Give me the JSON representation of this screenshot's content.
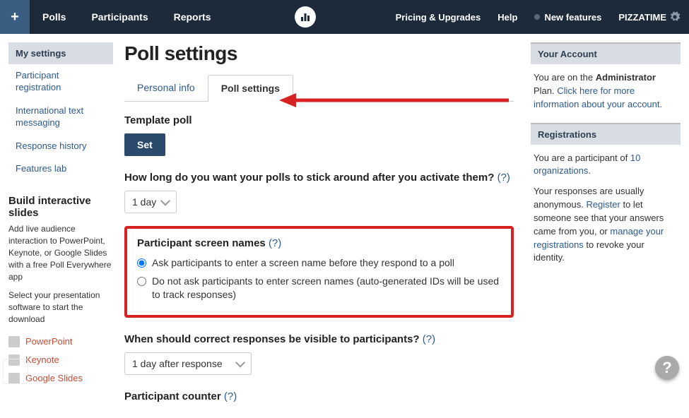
{
  "nav": {
    "plus": "+",
    "items": [
      "Polls",
      "Participants",
      "Reports"
    ],
    "right": [
      "Pricing & Upgrades",
      "Help",
      "New features"
    ],
    "user": "PIZZATIME"
  },
  "sidebar": {
    "tabs": [
      "My settings",
      "Participant registration",
      "International text messaging",
      "Response history",
      "Features lab"
    ],
    "build_heading": "Build interactive slides",
    "build_text": "Add live audience interaction to PowerPoint, Keynote, or Google Slides with a free Poll Everywhere app",
    "select_text": "Select your presentation software to start the download",
    "downloads": [
      "PowerPoint",
      "Keynote",
      "Google Slides"
    ]
  },
  "main": {
    "title": "Poll settings",
    "tabs": [
      "Personal info",
      "Poll settings"
    ],
    "template_label": "Template poll",
    "set_btn": "Set",
    "stick_q": "How long do you want your polls to stick around after you activate them?",
    "stick_val": "1 day",
    "screen_label": "Participant screen names",
    "radio1": "Ask participants to enter a screen name before they respond to a poll",
    "radio2": "Do not ask participants to enter screen names (auto-generated IDs will be used to track responses)",
    "correct_q": "When should correct responses be visible to participants?",
    "correct_val": "1 day after response",
    "counter_label": "Participant counter",
    "help": "(?)"
  },
  "right": {
    "account_head": "Your Account",
    "account_text1": "You are on the ",
    "account_plan": "Administrator",
    "account_text2": " Plan. ",
    "account_link": "Click here for more information about your account.",
    "reg_head": "Registrations",
    "reg_text1": "You are a participant of ",
    "reg_link1": "10 organizations",
    "reg_text2": ".",
    "reg_text3": "Your responses are usually anonymous. ",
    "reg_link2": "Register",
    "reg_text4": " to let someone see that your answers came from you, or ",
    "reg_link3": "manage your registrations",
    "reg_text5": " to revoke your identity."
  }
}
